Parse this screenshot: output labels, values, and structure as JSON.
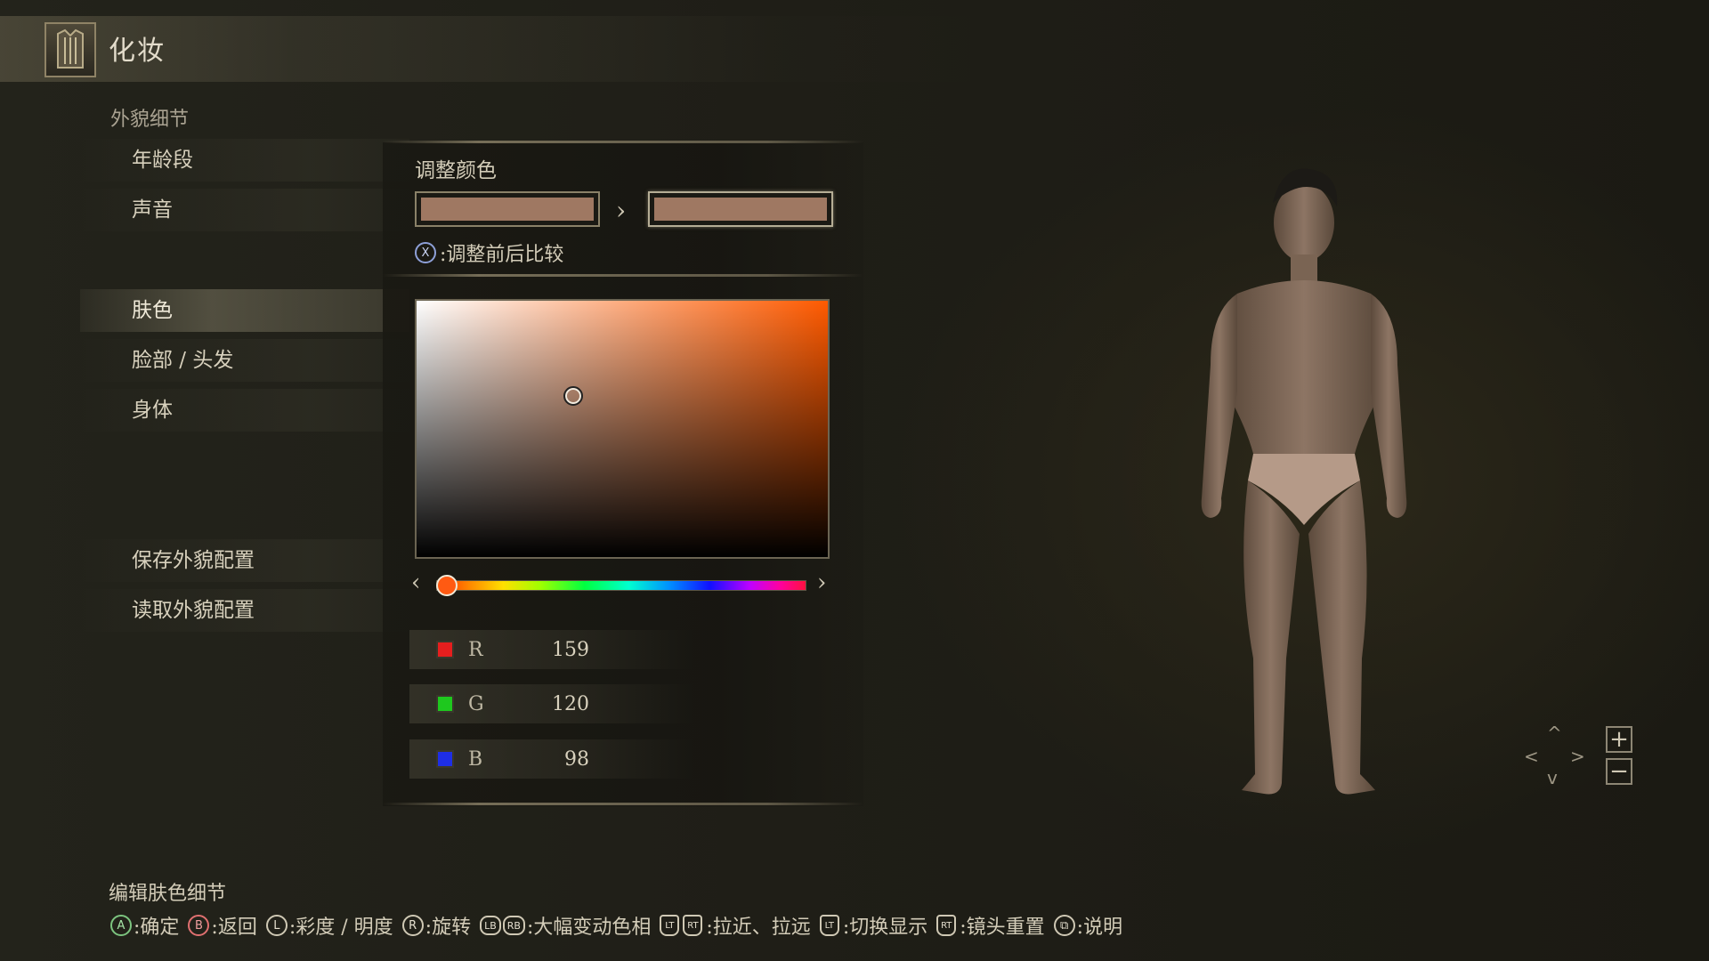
{
  "header": {
    "title": "化妆",
    "icon": "armor-icon"
  },
  "sidebar": {
    "section_label": "外貌细节",
    "items": [
      {
        "label": "年龄段"
      },
      {
        "label": "声音"
      },
      {
        "label": "肤色",
        "selected": true
      },
      {
        "label": "脸部 / 头发"
      },
      {
        "label": "身体"
      },
      {
        "label": "保存外貌配置"
      },
      {
        "label": "读取外貌配置"
      }
    ]
  },
  "color_panel": {
    "title": "调整颜色",
    "before_color": "#9f7862",
    "after_color": "#9f7862",
    "compare_button": "X",
    "compare_text": ":调整前后比较",
    "sv_hue_color": "#ff5a00",
    "hue_position": 0.03,
    "rgb": [
      {
        "label": "R",
        "value": "159",
        "chip": "#e61e1e"
      },
      {
        "label": "G",
        "value": "120",
        "chip": "#1ec81e"
      },
      {
        "label": "B",
        "value": "98",
        "chip": "#1e2ee6"
      }
    ]
  },
  "footer": {
    "title": "编辑肤色细节",
    "hints": [
      {
        "button": "A",
        "text": ":确定"
      },
      {
        "button": "B",
        "text": ":返回"
      },
      {
        "button": "L",
        "text": ":彩度 / 明度"
      },
      {
        "button": "R",
        "text": ":旋转"
      },
      {
        "button": "LB",
        "button2": "RB",
        "text": ":大幅变动色相"
      },
      {
        "button": "LT",
        "button2": "RT",
        "text": ":拉近、拉远"
      },
      {
        "button": "LT",
        "text": ":切换显示"
      },
      {
        "button": "RT",
        "text": ":镜头重置"
      },
      {
        "button": "⧉",
        "text": ":说明"
      }
    ]
  },
  "camera": {
    "zoom_in": "+",
    "zoom_out": "−"
  }
}
